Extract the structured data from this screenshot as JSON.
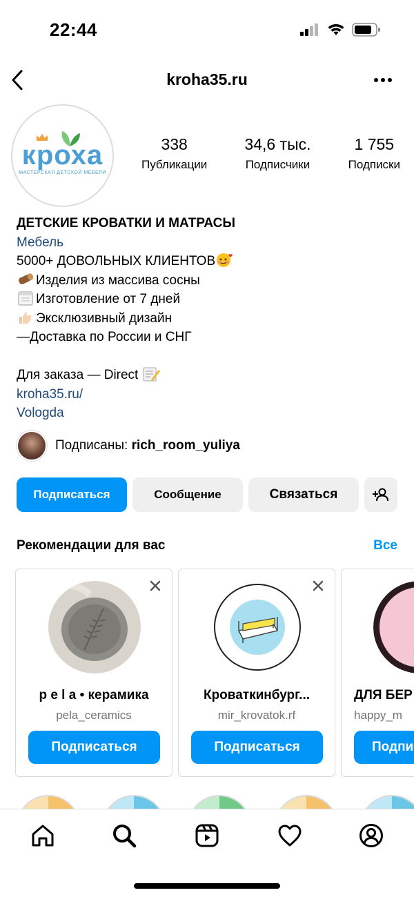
{
  "status": {
    "time": "22:44",
    "icons": [
      "cellular-signal-icon",
      "wifi-icon",
      "battery-icon"
    ]
  },
  "nav": {
    "username": "kroha35.ru",
    "back_icon": "chevron-left-icon",
    "more_icon": "more-horizontal-icon"
  },
  "avatar": {
    "brand": "кроха",
    "tagline": "МАСТЕРСКАЯ ДЕТСКОЙ МЕБЕЛИ"
  },
  "stats": [
    {
      "value": "338",
      "label": "Публикации"
    },
    {
      "value": "34,6 тыс.",
      "label": "Подписчики"
    },
    {
      "value": "1 755",
      "label": "Подписки"
    }
  ],
  "bio": {
    "name": "ДЕТСКИЕ КРОВАТКИ И МАТРАСЫ",
    "category": "Мебель",
    "line1": "5000+ ДОВОЛЬНЫХ КЛИЕНТОВ",
    "line2": "Изделия из массива сосны",
    "line3": "Изготовление от 7 дней",
    "line4": "Эксклюзивный дизайн",
    "line5": "—Доставка по России и СНГ",
    "line6": "Для заказа — Direct",
    "website": "kroha35.ru/",
    "location": "Vologda"
  },
  "followed_by": {
    "label": "Подписаны:",
    "user": "rich_room_yuliya"
  },
  "actions": {
    "follow": "Подписаться",
    "message": "Сообщение",
    "contact": "Связаться",
    "add_icon": "add-person-icon"
  },
  "recommendations": {
    "title": "Рекомендации для вас",
    "see_all": "Все",
    "cards": [
      {
        "name": "p e l a • керамика",
        "username": "pela_ceramics",
        "button": "Подписаться"
      },
      {
        "name": "Кроваткинбург...",
        "username": "mir_krovatok.rf",
        "button": "Подписаться"
      },
      {
        "name": "ДЛЯ БЕР",
        "username": "happy_m",
        "button": "Подпи"
      }
    ]
  },
  "tabs": [
    "home-icon",
    "search-icon",
    "reels-icon",
    "heart-icon",
    "profile-icon"
  ],
  "colors": {
    "primary": "#0095f6",
    "link": "#1e4a7a",
    "secondary_bg": "#efefef",
    "muted": "#737373"
  }
}
